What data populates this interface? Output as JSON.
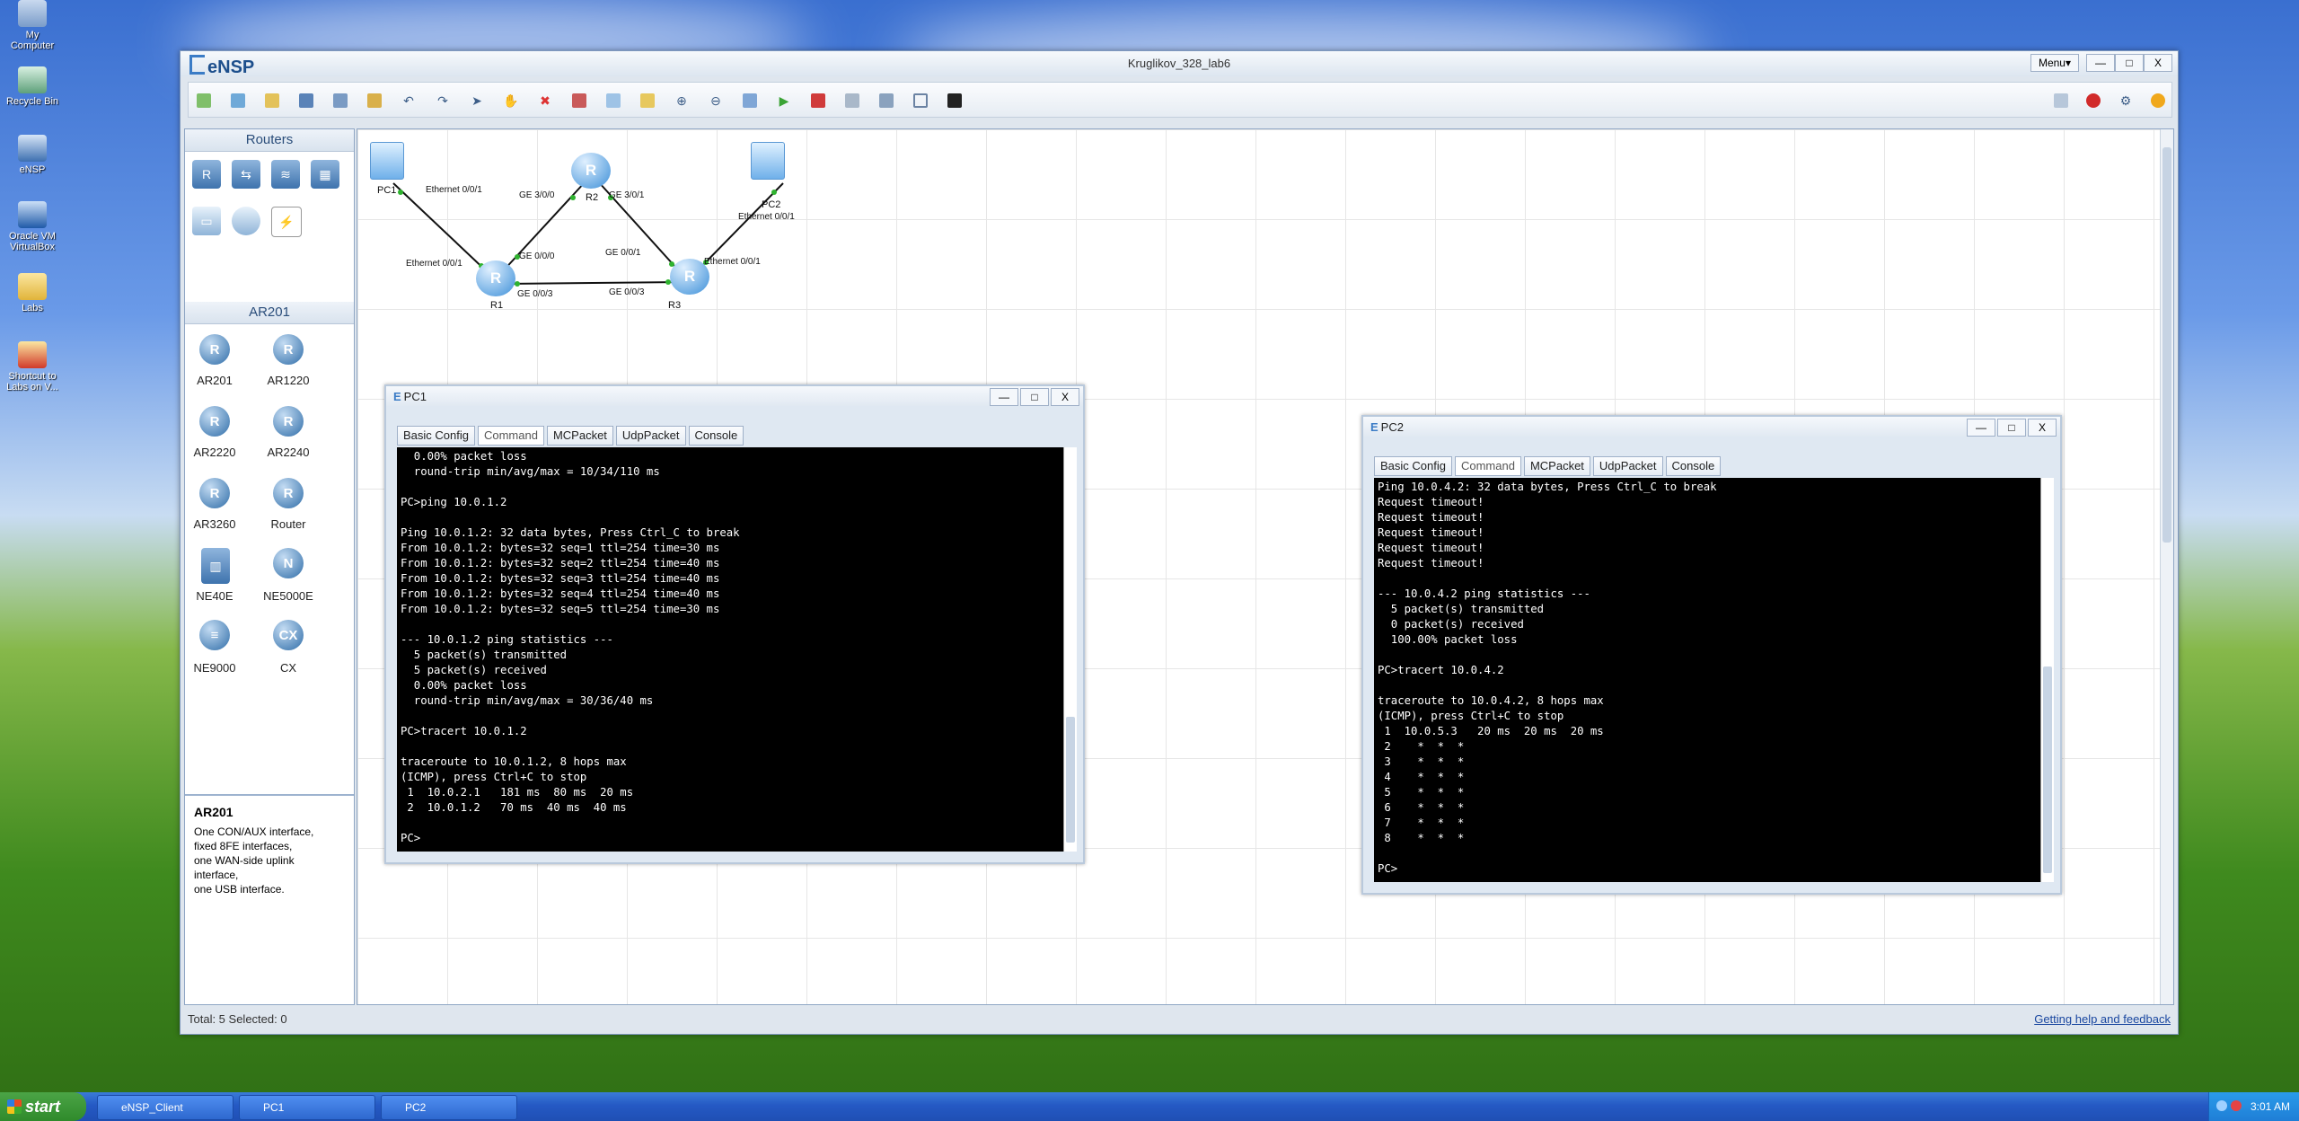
{
  "desktop": {
    "icons": [
      {
        "label": "My Computer"
      },
      {
        "label": "Recycle Bin"
      },
      {
        "label": "eNSP"
      },
      {
        "label": "Oracle VM VirtualBox"
      },
      {
        "label": "Labs"
      },
      {
        "label": "Shortcut to Labs on V..."
      }
    ]
  },
  "app": {
    "logo": "eNSP",
    "title": "Kruglikov_328_lab6",
    "menu_label": "Menu▾",
    "minimize": "—",
    "maximize": "□",
    "close": "X"
  },
  "left_panel": {
    "routers_header": "Routers",
    "model_header": "AR201",
    "devices": [
      {
        "label": "AR201"
      },
      {
        "label": "AR1220"
      },
      {
        "label": "AR2220"
      },
      {
        "label": "AR2240"
      },
      {
        "label": "AR3260"
      },
      {
        "label": "Router"
      },
      {
        "label": "NE40E"
      },
      {
        "label": "NE5000E"
      },
      {
        "label": "NE9000"
      },
      {
        "label": "CX"
      }
    ],
    "description": {
      "title": "AR201",
      "text": "One CON/AUX interface,\nfixed 8FE interfaces,\none WAN-side uplink\ninterface,\none USB interface."
    }
  },
  "topology": {
    "nodes": {
      "pc1": "PC1",
      "pc2": "PC2",
      "r1": "R1",
      "r2": "R2",
      "r3": "R3"
    },
    "ports": {
      "pc1_eth": "Ethernet 0/0/1",
      "r1_eth": "Ethernet 0/0/1",
      "r1_ge000": "GE 0/0/0",
      "r1_ge003": "GE 0/0/3",
      "r2_ge300": "GE 3/0/0",
      "r2_ge301": "GE 3/0/1",
      "r3_ge001": "GE 0/0/1",
      "r3_ge003": "GE 0/0/3",
      "r3_eth": "Ethernet 0/0/1",
      "pc2_eth": "Ethernet 0/0/1"
    }
  },
  "status": {
    "text": "Total: 5  Selected: 0",
    "help": "Getting help and feedback"
  },
  "pc1": {
    "title": "PC1",
    "tabs": [
      "Basic Config",
      "Command",
      "MCPacket",
      "UdpPacket",
      "Console"
    ],
    "terminal": "  0.00% packet loss\n  round-trip min/avg/max = 10/34/110 ms\n\nPC>ping 10.0.1.2\n\nPing 10.0.1.2: 32 data bytes, Press Ctrl_C to break\nFrom 10.0.1.2: bytes=32 seq=1 ttl=254 time=30 ms\nFrom 10.0.1.2: bytes=32 seq=2 ttl=254 time=40 ms\nFrom 10.0.1.2: bytes=32 seq=3 ttl=254 time=40 ms\nFrom 10.0.1.2: bytes=32 seq=4 ttl=254 time=40 ms\nFrom 10.0.1.2: bytes=32 seq=5 ttl=254 time=30 ms\n\n--- 10.0.1.2 ping statistics ---\n  5 packet(s) transmitted\n  5 packet(s) received\n  0.00% packet loss\n  round-trip min/avg/max = 30/36/40 ms\n\nPC>tracert 10.0.1.2\n\ntraceroute to 10.0.1.2, 8 hops max\n(ICMP), press Ctrl+C to stop\n 1  10.0.2.1   181 ms  80 ms  20 ms\n 2  10.0.1.2   70 ms  40 ms  40 ms\n\nPC>"
  },
  "pc2": {
    "title": "PC2",
    "tabs": [
      "Basic Config",
      "Command",
      "MCPacket",
      "UdpPacket",
      "Console"
    ],
    "terminal": "Ping 10.0.4.2: 32 data bytes, Press Ctrl_C to break\nRequest timeout!\nRequest timeout!\nRequest timeout!\nRequest timeout!\nRequest timeout!\n\n--- 10.0.4.2 ping statistics ---\n  5 packet(s) transmitted\n  0 packet(s) received\n  100.00% packet loss\n\nPC>tracert 10.0.4.2\n\ntraceroute to 10.0.4.2, 8 hops max\n(ICMP), press Ctrl+C to stop\n 1  10.0.5.3   20 ms  20 ms  20 ms\n 2    *  *  *\n 3    *  *  *\n 4    *  *  *\n 5    *  *  *\n 6    *  *  *\n 7    *  *  *\n 8    *  *  *\n\nPC>"
  },
  "taskbar": {
    "start": "start",
    "tasks": [
      {
        "label": "eNSP_Client"
      },
      {
        "label": "PC1"
      },
      {
        "label": "PC2"
      }
    ],
    "clock": "3:01 AM"
  }
}
